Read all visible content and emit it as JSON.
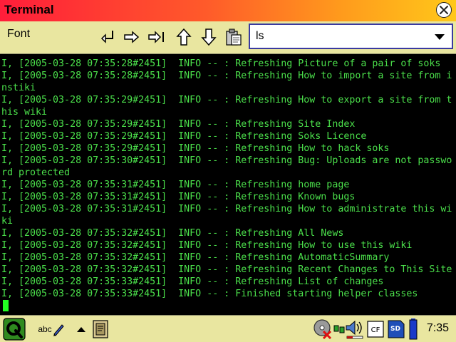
{
  "window": {
    "title": "Terminal"
  },
  "toolbar": {
    "font_menu": "Font",
    "buttons": [
      "return-icon",
      "tab-icon",
      "end-tab-icon",
      "arrow-up-icon",
      "arrow-down-icon",
      "paste-icon"
    ],
    "command_select": {
      "value": "ls"
    }
  },
  "terminal": {
    "lines": [
      "I, [2005-03-28 07:35:28#2451]  INFO -- : Refreshing Picture of a pair of soks",
      "I, [2005-03-28 07:35:28#2451]  INFO -- : Refreshing How to import a site from i",
      "nstiki",
      "I, [2005-03-28 07:35:29#2451]  INFO -- : Refreshing How to export a site from t",
      "his wiki",
      "I, [2005-03-28 07:35:29#2451]  INFO -- : Refreshing Site Index",
      "I, [2005-03-28 07:35:29#2451]  INFO -- : Refreshing Soks Licence",
      "I, [2005-03-28 07:35:29#2451]  INFO -- : Refreshing How to hack soks",
      "I, [2005-03-28 07:35:30#2451]  INFO -- : Refreshing Bug: Uploads are not passwo",
      "rd protected",
      "I, [2005-03-28 07:35:31#2451]  INFO -- : Refreshing home page",
      "I, [2005-03-28 07:35:31#2451]  INFO -- : Refreshing Known bugs",
      "I, [2005-03-28 07:35:31#2451]  INFO -- : Refreshing How to administrate this wi",
      "ki",
      "I, [2005-03-28 07:35:32#2451]  INFO -- : Refreshing All News",
      "I, [2005-03-28 07:35:32#2451]  INFO -- : Refreshing How to use this wiki",
      "I, [2005-03-28 07:35:32#2451]  INFO -- : Refreshing AutomaticSummary",
      "I, [2005-03-28 07:35:32#2451]  INFO -- : Refreshing Recent Changes to This Site",
      "I, [2005-03-28 07:35:33#2451]  INFO -- : Refreshing List of changes",
      "I, [2005-03-28 07:35:33#2451]  INFO -- : Finished starting helper classes"
    ]
  },
  "taskbar": {
    "input_method": "abc",
    "cf_label": "CF",
    "sd_label": "SD",
    "clock": "7:35"
  },
  "colors": {
    "terminal_text": "#4be04b",
    "terminal_bg": "#000000",
    "toolbar_bg": "#e9e6a0",
    "select_border": "#3a3aa0"
  }
}
